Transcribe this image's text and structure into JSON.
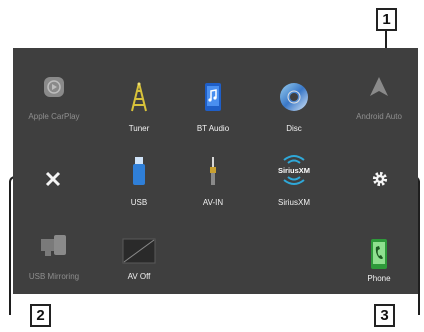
{
  "top_row": [
    {
      "label": "Apple CarPlay",
      "icon": "apple-carplay-icon",
      "enabled": false
    },
    {
      "label": "Tuner",
      "icon": "tuner-antenna-icon",
      "enabled": true
    },
    {
      "label": "BT Audio",
      "icon": "bt-audio-icon",
      "enabled": true
    },
    {
      "label": "Disc",
      "icon": "disc-icon",
      "enabled": true
    },
    {
      "label": "Android Auto",
      "icon": "android-auto-icon",
      "enabled": false
    }
  ],
  "middle_row": [
    {
      "label": "USB",
      "icon": "usb-icon",
      "enabled": true
    },
    {
      "label": "AV-IN",
      "icon": "av-in-icon",
      "enabled": true
    },
    {
      "label": "SiriusXM",
      "icon": "siriusxm-icon",
      "enabled": true
    }
  ],
  "bottom_row": [
    {
      "label": "USB Mirroring",
      "icon": "usb-mirroring-icon",
      "enabled": false
    },
    {
      "label": "AV Off",
      "icon": "av-off-icon",
      "enabled": true
    },
    {
      "label": "Phone",
      "icon": "phone-icon",
      "enabled": true
    }
  ],
  "controls": {
    "close_icon": "close-icon",
    "settings_icon": "gear-icon"
  },
  "callouts": [
    "1",
    "2",
    "3"
  ],
  "siriusxm_logo_text": "SiriusXM",
  "colors": {
    "screen_bg": "#3f3f3f",
    "label_enabled": "#f2f2f2",
    "label_disabled": "#8f8f8f",
    "callout_border": "#222222"
  }
}
